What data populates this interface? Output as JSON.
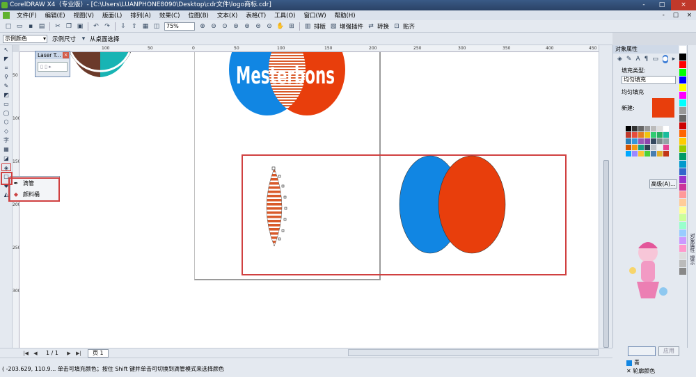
{
  "window": {
    "title": "CorelDRAW X4（专业版）- [C:\\Users\\LUANPHONE8090\\Desktop\\cdr文件\\logo商标.cdr]",
    "controls": [
      "-",
      "□",
      "×"
    ]
  },
  "menu": {
    "items": [
      "文件(F)",
      "编辑(E)",
      "视图(V)",
      "版面(L)",
      "排列(A)",
      "效果(C)",
      "位图(B)",
      "文本(X)",
      "表格(T)",
      "工具(O)",
      "窗口(W)",
      "帮助(H)"
    ],
    "doc_controls": [
      "-",
      "□",
      "×"
    ]
  },
  "toolbar1": {
    "zoom_value": "75%",
    "buttons": [
      "排版",
      "增强插件",
      "转换",
      "贴齐"
    ]
  },
  "toolbar2": {
    "color_mode": "示例颜色",
    "size_label": "示例尺寸",
    "desktop_select": "从桌面选择"
  },
  "rulers": {
    "h_ticks": [
      "100",
      "50",
      "0",
      "50",
      "100",
      "150",
      "200",
      "250",
      "300",
      "350",
      "400",
      "450"
    ],
    "v_ticks": [
      "50",
      "100",
      "150",
      "200",
      "250",
      "300"
    ]
  },
  "laser_window": {
    "title": "Laser T..."
  },
  "flyout": {
    "items": [
      {
        "label": "滴管",
        "icon": "eyedropper-icon"
      },
      {
        "label": "颜料桶",
        "icon": "paint-bucket-icon"
      }
    ]
  },
  "canvas": {
    "logo_text": "Mesterbons",
    "colors": {
      "blue": "#1186e3",
      "red": "#e83e0c",
      "stripe": "#d95a2a"
    }
  },
  "panel": {
    "title": "对象属性",
    "fill_type_label": "填充类型:",
    "fill_type_value": "均匀填充",
    "uniform_label": "均匀填充",
    "new_label": "新建:",
    "new_color": "#e83e0c",
    "advanced_button": "高级(A)...",
    "apply_button": "应用",
    "palette": [
      "#000000",
      "#333333",
      "#666666",
      "#999999",
      "#bbbbbb",
      "#dddddd",
      "#ffffff",
      "#c0392b",
      "#e74c3c",
      "#e67e22",
      "#f1c40f",
      "#2ecc71",
      "#27ae60",
      "#1abc9c",
      "#2980b9",
      "#3498db",
      "#9b59b6",
      "#8e44ad",
      "#34495e",
      "#7f8c8d",
      "#95a5a6",
      "#d35400",
      "#f39c12",
      "#16a085",
      "#2c3e50",
      "#bdc3c7",
      "#ecf0f1",
      "#e84393",
      "#00a8ff",
      "#9c88ff",
      "#fbc531",
      "#4cd137",
      "#487eb0",
      "#e1b12c",
      "#c23616"
    ]
  },
  "color_strip": [
    "#ffffff",
    "#000000",
    "#ff0000",
    "#00ff00",
    "#0000ff",
    "#ffff00",
    "#ff00ff",
    "#00ffff",
    "#999999",
    "#666666",
    "#cc0000",
    "#ff6600",
    "#ffcc00",
    "#99cc00",
    "#009966",
    "#0099cc",
    "#3366cc",
    "#9933cc",
    "#cc3399",
    "#ff9999",
    "#ffcc99",
    "#ffff99",
    "#ccff99",
    "#99ffcc",
    "#99ccff",
    "#cc99ff",
    "#ff99cc",
    "#dddddd",
    "#bbbbbb",
    "#888888"
  ],
  "right_tabs": [
    "对象属性",
    "提示"
  ],
  "bottom": {
    "page_counter": "1 / 1",
    "page_tab": "页 1"
  },
  "status": {
    "text": "( -203.629, 110.9... 单击可填充颜色；按住 Shift 键并单击可切换到滴管模式来选择颜色",
    "fill_color_name": "青",
    "fill_color": "#1186e3",
    "outline_label": "轮廓颜色"
  }
}
